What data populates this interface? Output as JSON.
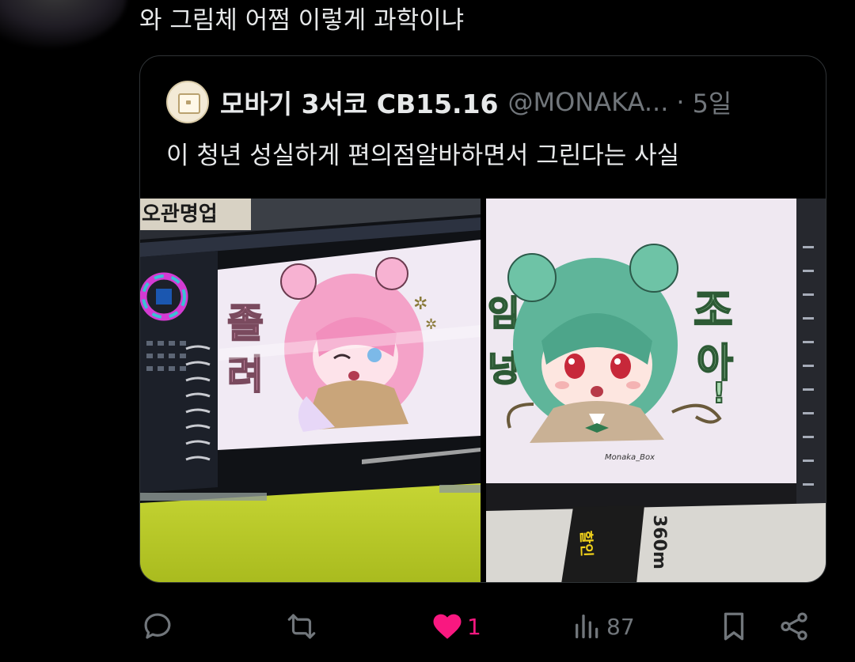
{
  "tweet": {
    "text": "와 그림체 어쩜 이렇게 과학이냐"
  },
  "quote": {
    "author_name": "모바기 3서코 CB15.16",
    "handle": "@MONAKA...",
    "separator": "·",
    "time": "5일",
    "text": "이 청년 성실하게 편의점알바하면서 그린다는 사실"
  },
  "actions": {
    "reply_icon": "speech-bubble-icon",
    "retweet_icon": "retweet-arrows-icon",
    "like_icon": "heart-filled-icon",
    "like_count": "1",
    "views_icon": "bar-chart-icon",
    "views_count": "87",
    "bookmark_icon": "bookmark-icon",
    "share_icon": "share-icon"
  },
  "colors": {
    "background": "#000000",
    "text_primary": "#e7e9ea",
    "text_secondary": "#71767b",
    "border": "#2f3336",
    "like_pink": "#f91880"
  }
}
